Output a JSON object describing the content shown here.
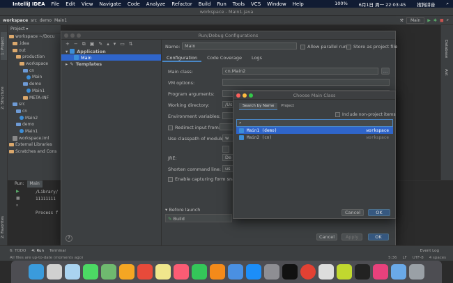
{
  "menubar": {
    "apple": "",
    "app": "IntelliJ IDEA",
    "items": [
      "File",
      "Edit",
      "View",
      "Navigate",
      "Code",
      "Analyze",
      "Refactor",
      "Build",
      "Run",
      "Tools",
      "VCS",
      "Window",
      "Help"
    ],
    "battery": "100%",
    "date": "6月1日 周一 22:03:45",
    "input": "搜狗拼音"
  },
  "window": {
    "title": "workspace - Main1.java"
  },
  "navbar": {
    "crumbs": [
      "workspace",
      "src",
      "demo",
      "Main1"
    ],
    "run_config": "Main"
  },
  "project": {
    "header": "Project ▾",
    "tree": [
      "workspace ~/Docu",
      "  .idea",
      "  out",
      "    production",
      "      workspace",
      "        cn",
      "          Main",
      "        demo",
      "          Main1",
      "        META-INF",
      "  src",
      "    cn",
      "      Main2",
      "    demo",
      "      Main1",
      "  workspace.iml",
      "External Libraries",
      "Scratches and Cons"
    ]
  },
  "run": {
    "label": "Run:",
    "tab": "Main",
    "lines": [
      "/Library/",
      "11111111",
      "",
      "Process f"
    ]
  },
  "left_strip": {
    "project": "1: Project",
    "structure": "2: Structure",
    "favorites": "2: Favorites"
  },
  "right_strip": {
    "database": "Database",
    "ant": "Ant"
  },
  "dialog": {
    "title": "Run/Debug Configurations",
    "tree": {
      "application": "Application",
      "main": "Main",
      "templates": "Templates"
    },
    "name_label": "Name:",
    "name_value": "Main",
    "allow_parallel": "Allow parallel run",
    "store_project": "Store as project file",
    "tabs": [
      "Configuration",
      "Code Coverage",
      "Logs"
    ],
    "fields": {
      "main_class": "Main class:",
      "main_class_value": "cn.Main2",
      "vm": "VM options:",
      "program_args": "Program arguments:",
      "working_dir": "Working directory:",
      "working_dir_value": "/Us",
      "env": "Environment variables:",
      "redirect": "Redirect input from:",
      "classpath": "Use classpath of module:",
      "classpath_value": "w",
      "jre": "JRE:",
      "jre_value": "De",
      "shorten": "Shorten command line:",
      "shorten_value": "us",
      "capture": "Enable capturing form snap"
    },
    "before_launch": "Before launch",
    "build": "Build",
    "cancel": "Cancel",
    "apply": "Apply",
    "ok": "OK",
    "help": "?"
  },
  "chooser": {
    "title": "Choose Main Class",
    "tabs": [
      "Search by Name",
      "Project"
    ],
    "include": "Include non-project items",
    "search_placeholder": "",
    "rows": [
      {
        "name": "Main1 (demo)",
        "module": "workspace"
      },
      {
        "name": "Main2 (cn)",
        "module": "workspace"
      }
    ],
    "cancel": "Cancel",
    "ok": "OK"
  },
  "status": {
    "todo": "6: TODO",
    "run": "4: Run",
    "terminal": "Terminal",
    "event_log": "Event Log",
    "msg": "All files are up-to-date (moments ago)",
    "pos": "5:36",
    "lf": "LF",
    "enc": "UTF-8",
    "indent": "4 spaces"
  },
  "colors": {
    "accent": "#2f65ca",
    "button_primary": "#365880"
  }
}
